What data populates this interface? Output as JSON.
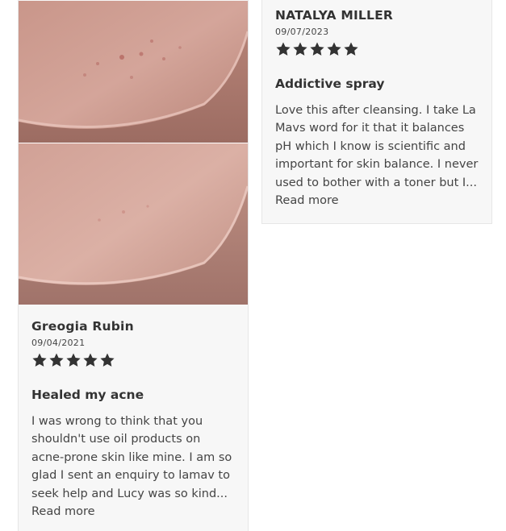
{
  "reviews": [
    {
      "author": "Greogia Rubin",
      "date": "09/04/2021",
      "rating": 5,
      "headline": "Healed my acne",
      "text": "I was wrong to think that you shouldn't use oil products on acne-prone skin like mine. I am so glad I sent an enquiry to lamav to seek help and Lucy was so kind...",
      "read_more": "Read more"
    },
    {
      "author": "NATALYA MILLER",
      "date": "09/07/2023",
      "rating": 5,
      "headline": "Addictive spray",
      "text": "Love this after cleansing. I take La Mavs word for it that it balances pH which I know is scientific and important for skin balance. I never used to bother with a toner but I...",
      "read_more": "Read more"
    }
  ],
  "icons": {
    "star": "star-icon",
    "photo": "skin-photo"
  },
  "colors": {
    "star": "#333333",
    "card_bg": "#f7f7f7",
    "text": "#444444"
  }
}
